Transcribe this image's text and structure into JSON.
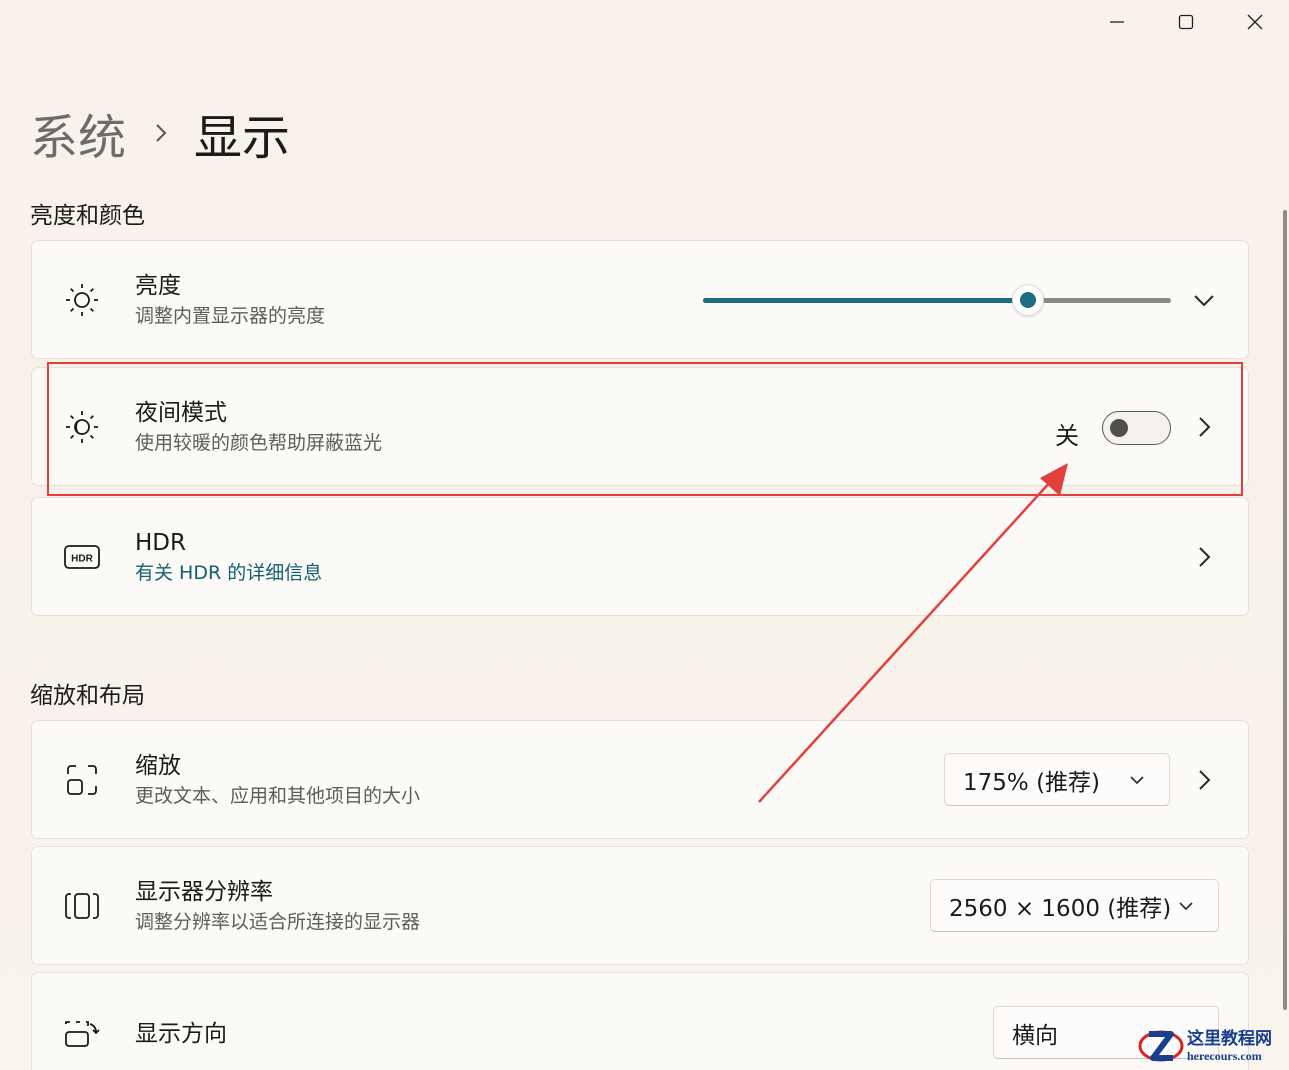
{
  "breadcrumb": {
    "parent": "系统",
    "current": "显示"
  },
  "sections": {
    "brightness_color": "亮度和颜色",
    "scale_layout": "缩放和布局"
  },
  "brightness": {
    "title": "亮度",
    "subtitle": "调整内置显示器的亮度",
    "value_fraction": 0.695
  },
  "night_light": {
    "title": "夜间模式",
    "subtitle": "使用较暖的颜色帮助屏蔽蓝光",
    "state_label": "关"
  },
  "hdr": {
    "title": "HDR",
    "link": "有关 HDR 的详细信息"
  },
  "scale": {
    "title": "缩放",
    "subtitle": "更改文本、应用和其他项目的大小",
    "value": "175% (推荐)"
  },
  "resolution": {
    "title": "显示器分辨率",
    "subtitle": "调整分辨率以适合所连接的显示器",
    "value": "2560 × 1600 (推荐)"
  },
  "orientation": {
    "title": "显示方向",
    "value": "横向"
  },
  "watermark": {
    "cn": "这里教程网",
    "en": "herecours.com"
  },
  "colors": {
    "accent": "#1f6b7f",
    "annotation": "#e2403f"
  }
}
